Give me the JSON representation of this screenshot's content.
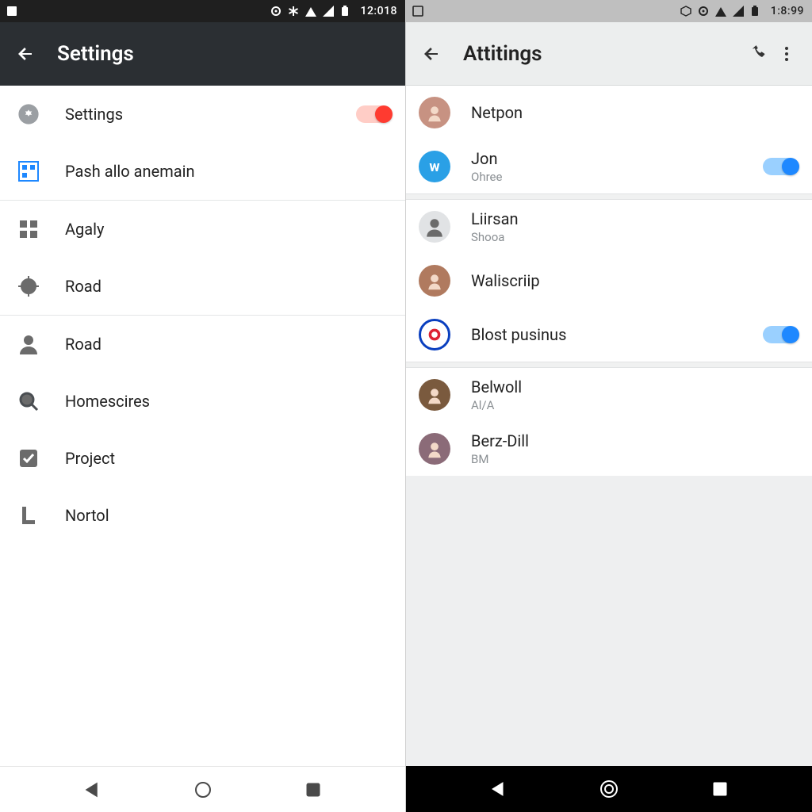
{
  "left_phone": {
    "statusbar": {
      "time": "12:018",
      "icons": [
        "square",
        "target",
        "asterisk",
        "wifi",
        "signal",
        "battery"
      ]
    },
    "appbar": {
      "title": "Settings"
    },
    "sections": [
      [
        {
          "icon": "gear-circle",
          "label": "Settings",
          "toggle": "red-on"
        },
        {
          "icon": "grid-blue",
          "label": "Pash allo anemain"
        }
      ],
      [
        {
          "icon": "grid",
          "label": "Agaly"
        },
        {
          "icon": "scope",
          "label": "Road"
        }
      ],
      [
        {
          "icon": "person",
          "label": "Road"
        },
        {
          "icon": "magnifier",
          "label": "Homescires"
        },
        {
          "icon": "check-box",
          "label": "Project"
        },
        {
          "icon": "l-shape",
          "label": "Nortol"
        }
      ]
    ]
  },
  "right_phone": {
    "statusbar": {
      "time": "1:8:99",
      "icons": [
        "square-outline",
        "cube",
        "target",
        "wifi",
        "signal",
        "battery"
      ]
    },
    "appbar": {
      "title": "Attitings",
      "actions": [
        "phone",
        "more-vert"
      ]
    },
    "groups": [
      [
        {
          "avatar": "face1",
          "avatar_bg": "#c79282",
          "label": "Netpon"
        },
        {
          "avatar": "w-badge",
          "avatar_bg": "#2aa0e6",
          "label": "Jon",
          "sub": "Ohree",
          "toggle": "blue-on"
        }
      ],
      [
        {
          "avatar": "silhouette",
          "avatar_bg": "#e1e3e5",
          "label": "Liirsan",
          "sub": "Shooa"
        },
        {
          "avatar": "face2",
          "avatar_bg": "#b07a5f",
          "label": "Waliscriip"
        },
        {
          "avatar": "o-badge",
          "avatar_bg": "#0a3fbf",
          "label": "Blost pusinus",
          "toggle": "blue-on"
        }
      ],
      [
        {
          "avatar": "face3",
          "avatar_bg": "#7a5a3e",
          "label": "Belwoll",
          "sub": "Al/A"
        },
        {
          "avatar": "face4",
          "avatar_bg": "#8b6b78",
          "label": "Berz-Dill",
          "sub": "B﻿M"
        }
      ]
    ]
  }
}
